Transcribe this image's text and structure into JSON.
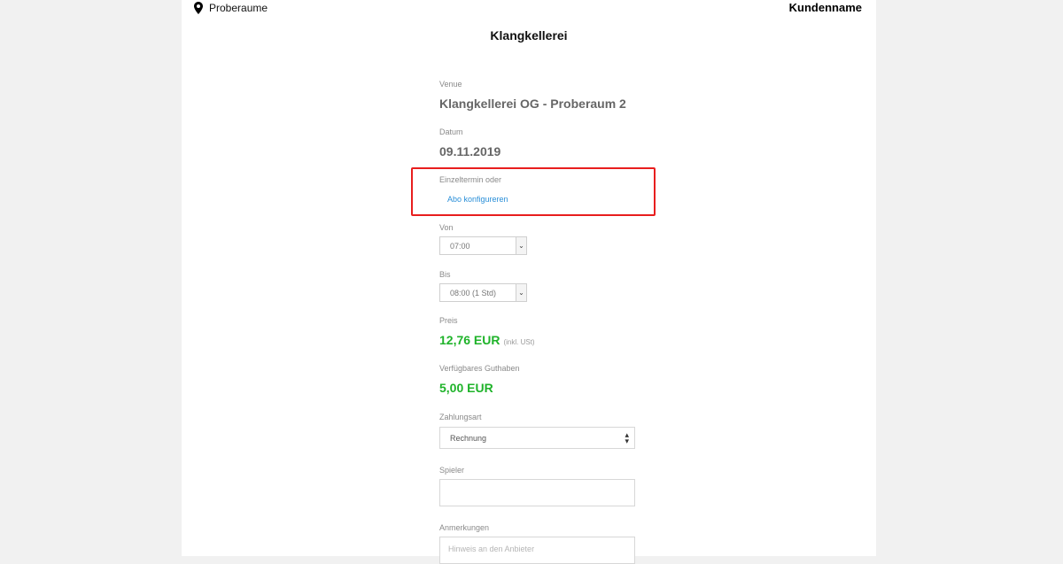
{
  "nav": {
    "location_label": "Proberaume",
    "customer_name": "Kundenname"
  },
  "page_title": "Klangkellerei",
  "form": {
    "venue": {
      "label": "Venue",
      "value": "Klangkellerei OG - Proberaum 2"
    },
    "datum": {
      "label": "Datum",
      "value": "09.11.2019"
    },
    "booking_type": {
      "label": "Einzeltermin oder",
      "link": "Abo konfigureren"
    },
    "von": {
      "label": "Von",
      "selected": "07:00"
    },
    "bis": {
      "label": "Bis",
      "selected": "08:00 (1 Std)"
    },
    "preis": {
      "label": "Preis",
      "value": "12,76 EUR",
      "note": "(inkl. USt)"
    },
    "guthaben": {
      "label": "Verfügbares Guthaben",
      "value": "5,00 EUR"
    },
    "zahlungsart": {
      "label": "Zahlungsart",
      "selected": "Rechnung"
    },
    "spieler": {
      "label": "Spieler",
      "value": ""
    },
    "anmerkungen": {
      "label": "Anmerkungen",
      "placeholder": "Hinweis an den Anbieter"
    }
  },
  "colors": {
    "price_green": "#1fb32a",
    "link_blue": "#2a8fd8",
    "highlight_red": "#e81e1e"
  },
  "icons": {
    "location": "map-pin-icon"
  }
}
